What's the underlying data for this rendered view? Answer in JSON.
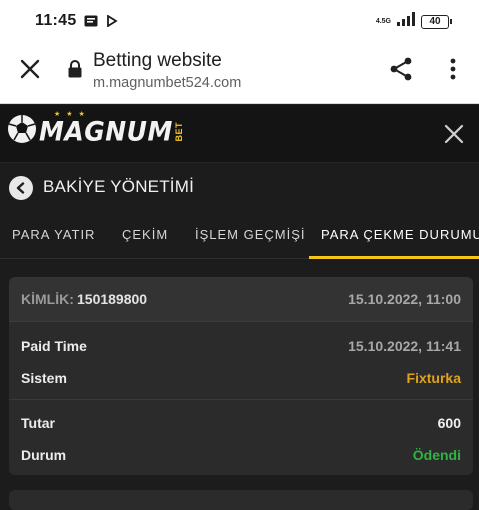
{
  "status_bar": {
    "time": "11:45",
    "network": "4.5G",
    "battery": "40"
  },
  "browser": {
    "title": "Betting website",
    "url": "m.magnumbet524.com"
  },
  "site": {
    "logo_text": "MAGNUM",
    "logo_suffix": "BET"
  },
  "page": {
    "title": "BAKİYE YÖNETİMİ"
  },
  "tabs": [
    {
      "label": "PARA YATIR"
    },
    {
      "label": "ÇEKİM"
    },
    {
      "label": "İŞLEM GEÇMİŞİ"
    },
    {
      "label": "PARA ÇEKME DURUMU",
      "active": true
    }
  ],
  "withdrawal": {
    "id_label": "KİMLİK:",
    "id_value": "150189800",
    "created": "15.10.2022, 11:00",
    "paid_time_label": "Paid Time",
    "paid_time_value": "15.10.2022, 11:41",
    "system_label": "Sistem",
    "system_value": "Fixturka",
    "amount_label": "Tutar",
    "amount_value": "600",
    "status_label": "Durum",
    "status_value": "Ödendi"
  },
  "colors": {
    "accent": "#f5c518",
    "system_value": "#e0a21b",
    "status_paid": "#2fb344",
    "amount_value": "#f0f0f0"
  }
}
